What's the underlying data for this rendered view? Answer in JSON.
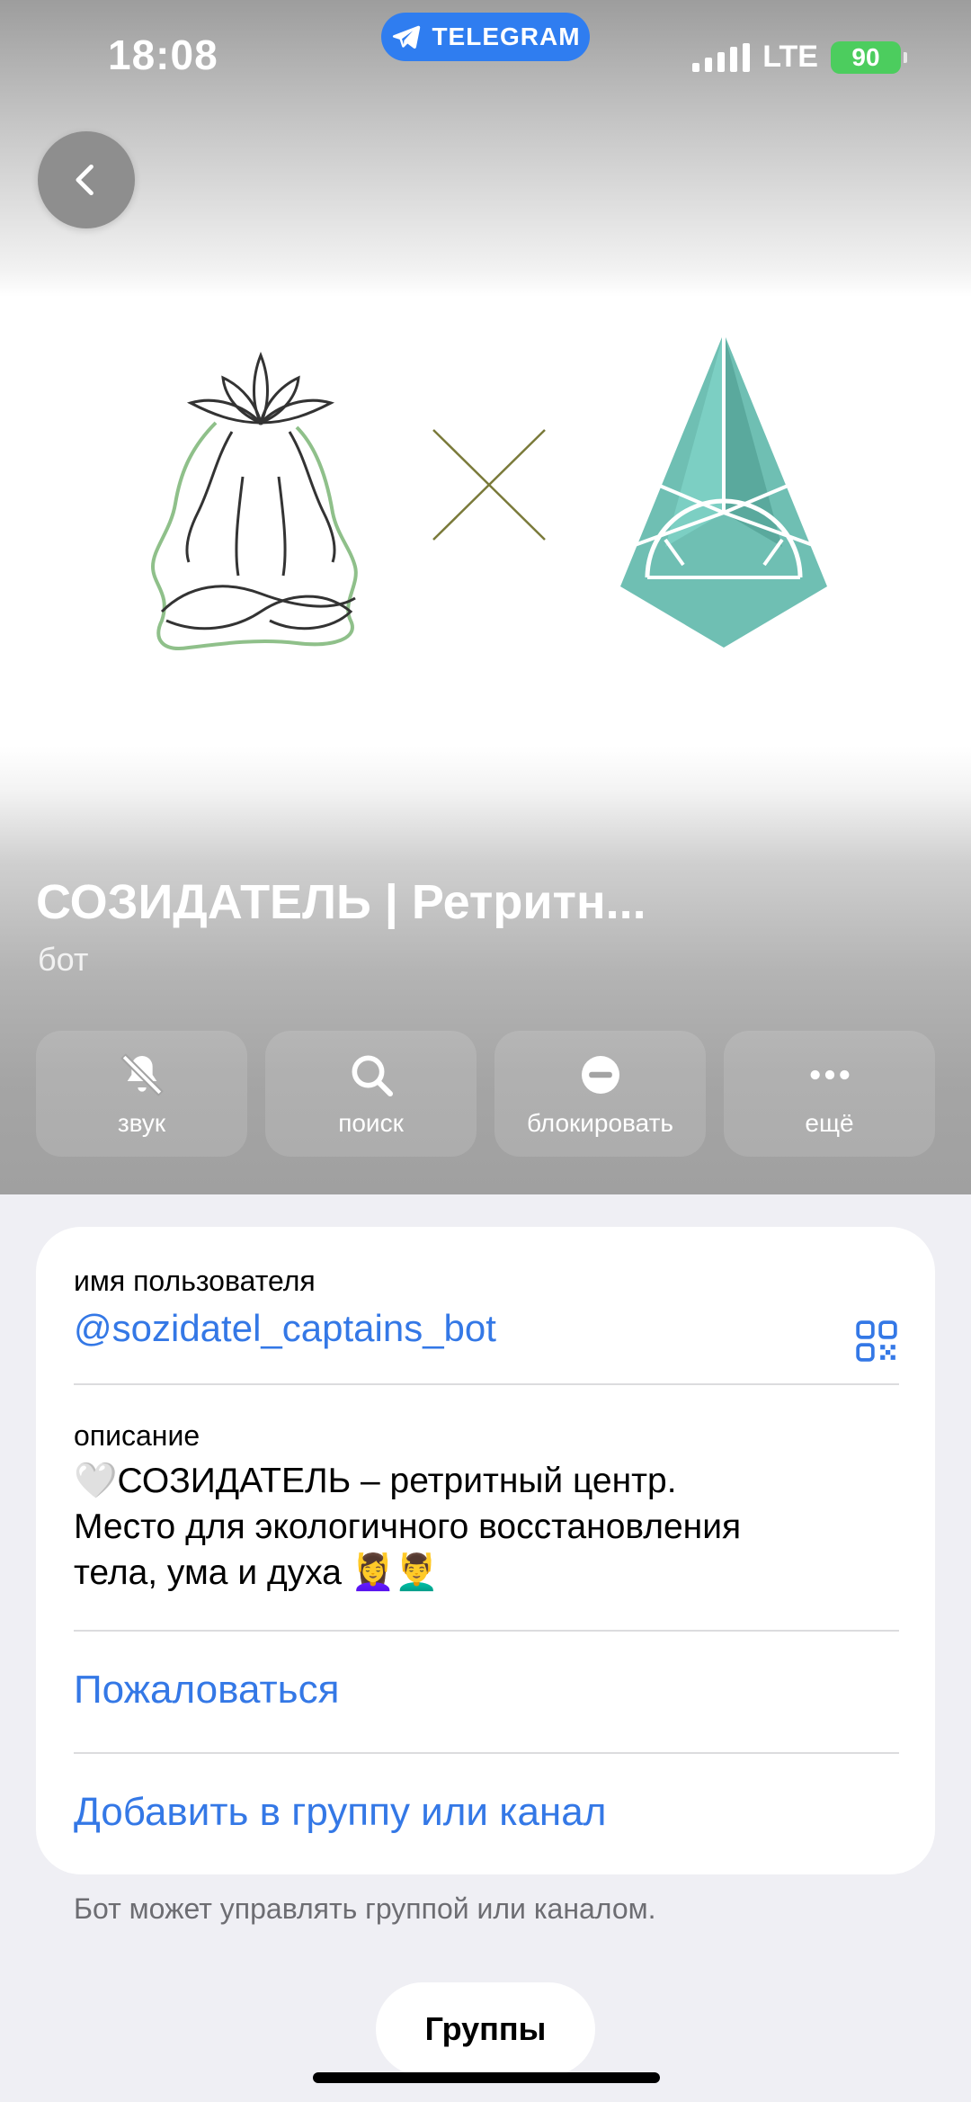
{
  "status_bar": {
    "time": "18:08",
    "app_pill": "TELEGRAM",
    "network": "LTE",
    "battery": "90"
  },
  "header": {
    "bot_name": "СОЗИДАТЕЛЬ | Ретритн...",
    "subtitle": "бот"
  },
  "actions": [
    {
      "label": "звук",
      "icon": "bell-slash-icon"
    },
    {
      "label": "поиск",
      "icon": "search-icon"
    },
    {
      "label": "блокировать",
      "icon": "block-icon"
    },
    {
      "label": "ещё",
      "icon": "more-icon"
    }
  ],
  "info": {
    "username_label": "имя пользователя",
    "username": "@sozidatel_captains_bot",
    "description_label": "описание",
    "description_lines": [
      "🤍СОЗИДАТЕЛЬ – ретритный центр.",
      "Место для экологичного восстановления",
      "тела, ума и духа 💆‍♀️💆‍♂️"
    ],
    "report_link": "Пожаловаться",
    "add_link": "Добавить в группу или канал"
  },
  "footnote": "Бот может управлять группой или каналом.",
  "bottom_button": "Группы",
  "colors": {
    "accent": "#3478e6",
    "telegram_pill": "#2f7df0",
    "battery": "#4ccd5e",
    "logo_teal": "#6fbfb3",
    "logo_green": "#8fc08a"
  }
}
